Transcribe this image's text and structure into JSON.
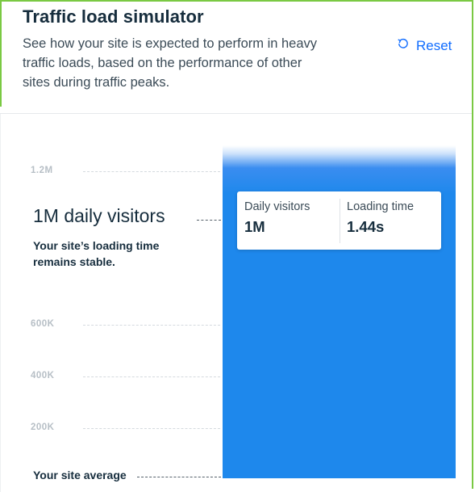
{
  "header": {
    "title": "Traffic load simulator",
    "description": "See how your site is expected to perform in heavy traffic loads, based on the performance of other sites during traffic peaks.",
    "reset_label": "Reset"
  },
  "chart": {
    "ticks": [
      "1.2M",
      "600K",
      "400K",
      "200K"
    ],
    "current_label": "1M daily visitors",
    "current_sub": "Your site’s loading time remains stable.",
    "baseline_label": "Your site average",
    "bar_color": "#1e88ec"
  },
  "tooltip": {
    "visitors_label": "Daily visitors",
    "visitors_value": "1M",
    "loading_label": "Loading time",
    "loading_value": "1.44s"
  },
  "accent_color": "#116dff",
  "frame_color": "#7ac943"
}
